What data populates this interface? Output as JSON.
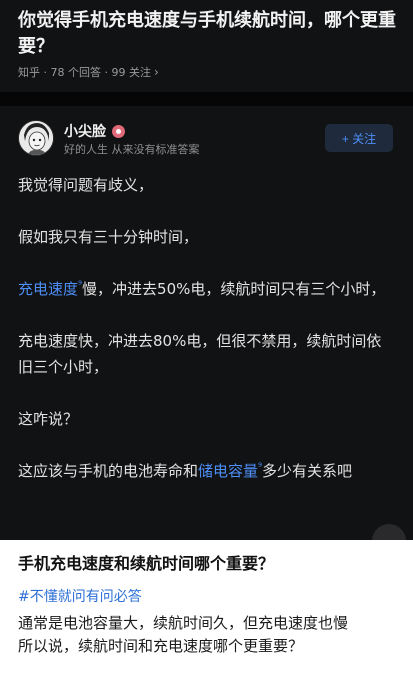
{
  "question": {
    "title": "你觉得手机充电速度与手机续航时间，哪个更重要？",
    "meta": "知乎 · 78 个回答 · 99 关注",
    "meta_chevron_icon": "chevron-right-icon"
  },
  "author": {
    "name": "小尖脸",
    "badge_icon": "verified-badge-icon",
    "bio": "好的人生 从来没有标准答案",
    "follow_label": "+ 关注"
  },
  "answer": {
    "p1": "我觉得问题有歧义，",
    "p2": "假如我只有三十分钟时间，",
    "p3_link": "充电速度",
    "p3_rest": "慢，冲进去50%电，续航时间只有三个小时，",
    "p4": "充电速度快，冲进去80%电，但很不禁用，续航时间依旧三个小时，",
    "p5": "这咋说？",
    "p6_pre": "这应该与手机的电池寿命和",
    "p6_link": "储电容量",
    "p6_post": "多少有关系吧",
    "search_icon": "search-sup-icon"
  },
  "section": {
    "title": "手机充电速度和续航时间哪个重要？",
    "tag": "#不懂就问有问必答",
    "line1": "通常是电池容量大，续航时间久，但充电速度也慢",
    "line2": "所以说，续航时间和充电速度哪个更重要？"
  },
  "colors": {
    "dark_bg": "#111214",
    "link": "#4d8ef7",
    "tag": "#2d6fd6"
  }
}
